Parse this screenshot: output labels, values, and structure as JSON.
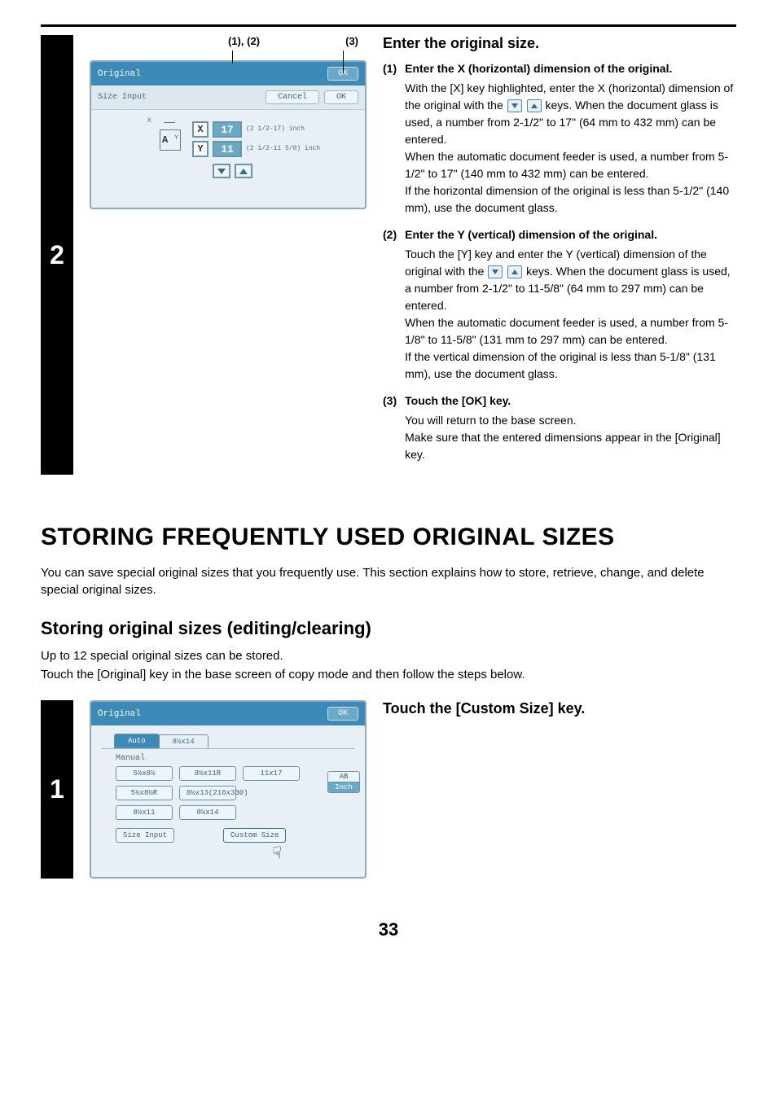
{
  "topBar": {},
  "step2": {
    "number": "2",
    "callouts": {
      "left": "(1), (2)",
      "right": "(3)"
    },
    "panel": {
      "title": "Original",
      "ok": "OK",
      "subLabel": "Size Input",
      "cancel": "Cancel",
      "ok2": "OK",
      "xLabel": "X",
      "xValue": "17",
      "xRange": "(2 1/2-17) inch",
      "yLabel": "Y",
      "yValue": "11",
      "yRange": "(2 1/2-11 5/8) inch"
    },
    "right": {
      "title": "Enter the original size.",
      "sub1_num": "(1)",
      "sub1_head": "Enter the X (horizontal) dimension of the original.",
      "sub1_p1a": "With the [X] key highlighted, enter the X (horizontal) dimension of the original with the ",
      "sub1_p1b": " keys. When the document glass is used, a number from 2-1/2\" to 17\" (64 mm to 432 mm) can be entered.",
      "sub1_p2": "When the automatic document feeder is used, a number from 5-1/2\" to 17\" (140 mm to 432 mm) can be entered.",
      "sub1_p3": "If the horizontal dimension of the original is less than 5-1/2\" (140 mm), use the document glass.",
      "sub2_num": "(2)",
      "sub2_head": "Enter the Y (vertical) dimension of the original.",
      "sub2_p1a": "Touch the [Y] key and enter the Y (vertical) dimension of the original with the ",
      "sub2_p1b": " keys. When the document glass is used, a number from 2-1/2\" to 11-5/8\" (64 mm to 297 mm) can be entered.",
      "sub2_p2": "When the automatic document feeder is used, a number from 5-1/8\" to 11-5/8\" (131 mm to 297 mm) can be entered.",
      "sub2_p3": "If the vertical dimension of the original is less than 5-1/8\" (131 mm), use the document glass.",
      "sub3_num": "(3)",
      "sub3_head": "Touch the [OK] key.",
      "sub3_p1": "You will return to the base screen.",
      "sub3_p2": "Make sure that the entered dimensions appear in the [Original] key."
    }
  },
  "section": {
    "title": "STORING FREQUENTLY USED ORIGINAL SIZES",
    "desc": "You can save special original sizes that you frequently use. This section explains how to store, retrieve, change, and delete special original sizes.",
    "subTitle": "Storing original sizes (editing/clearing)",
    "subDescL1": "Up to 12 special original sizes can be stored.",
    "subDescL2": "Touch the [Original] key in the base screen of copy mode and then follow the steps below."
  },
  "step1": {
    "number": "1",
    "title": "Touch the [Custom Size] key.",
    "panel": {
      "title": "Original",
      "ok": "OK",
      "tabAuto": "Auto",
      "tabAutoDoc": "8½x14",
      "manual": "Manual",
      "sizes": [
        "5½x8½",
        "8½x11R",
        "11x17",
        "5½x8½R",
        "8½x13(216x330)",
        "8½x11",
        "8½x14"
      ],
      "ab": "AB",
      "inch": "Inch",
      "sizeInput": "Size Input",
      "customSize": "Custom Size"
    }
  },
  "page": "33"
}
